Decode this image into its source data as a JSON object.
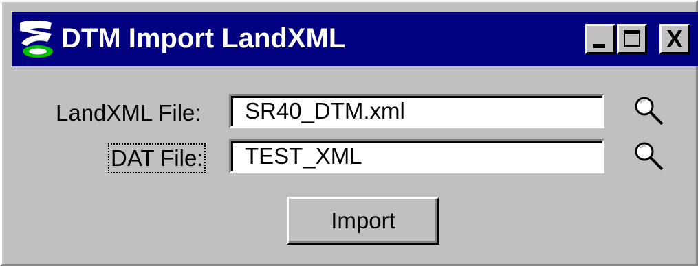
{
  "window": {
    "title": "DTM Import LandXML",
    "icon": "app-z-logo-icon",
    "controls": {
      "minimize": "minimize-icon",
      "maximize": "maximize-icon",
      "close_label": "X"
    }
  },
  "form": {
    "landxml_label": "LandXML File:",
    "landxml_value": "SR40_DTM.xml",
    "dat_label": "DAT File:",
    "dat_value": "TEST_XML",
    "browse_icon": "magnifier-icon",
    "import_label": "Import"
  },
  "colors": {
    "titlebar": "#000080",
    "face": "#c0c0c0",
    "field": "#ffffff"
  }
}
